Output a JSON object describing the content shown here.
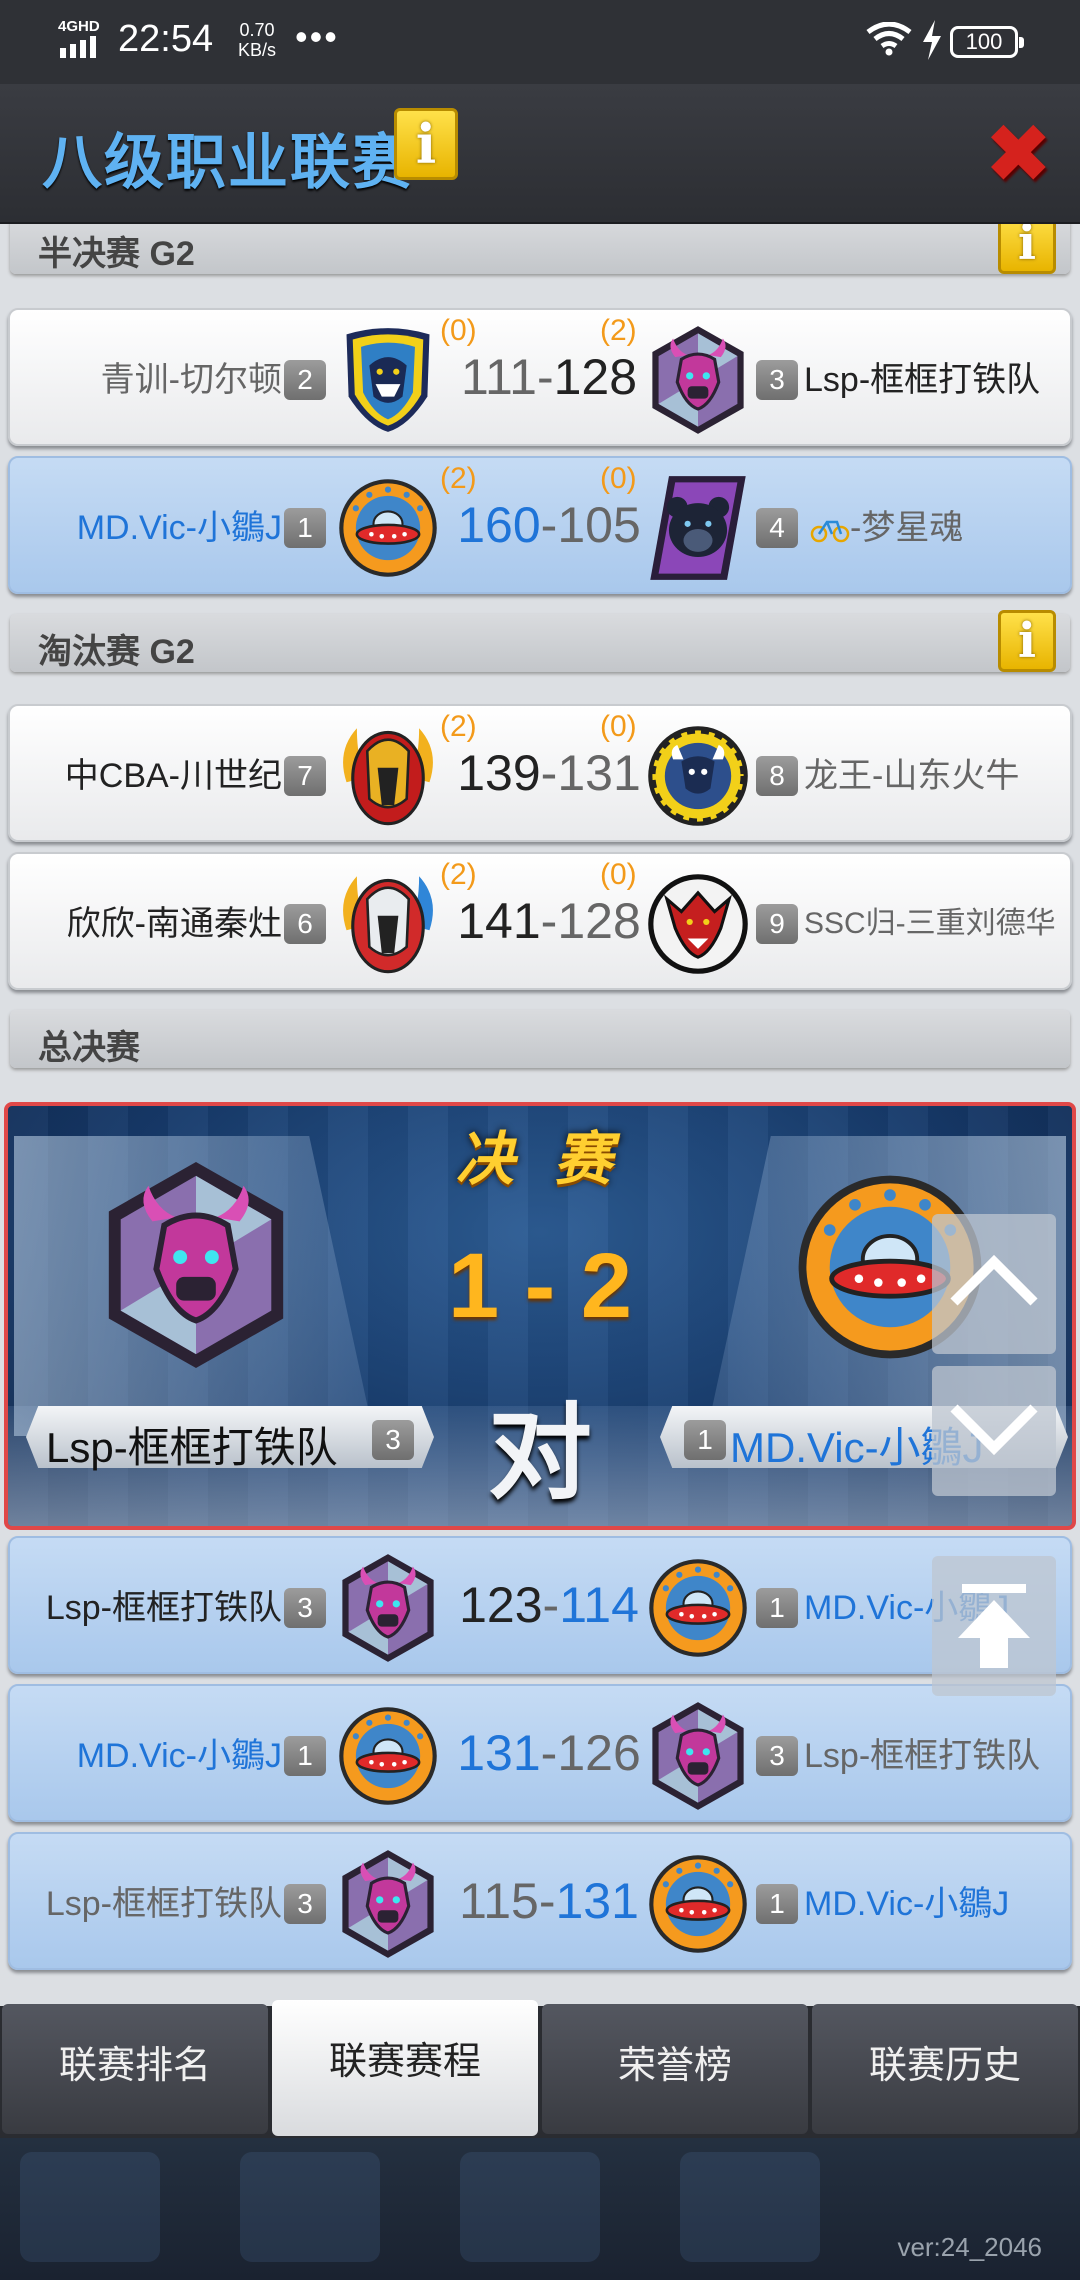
{
  "status_bar": {
    "network": "4GHD",
    "time": "22:54",
    "speed_value": "0.70",
    "speed_unit": "KB/s",
    "more": "•••",
    "battery": "100"
  },
  "header": {
    "title": "八级职业联赛",
    "info": "i",
    "close": "✖"
  },
  "sections": {
    "semifinal": "半决赛 G2",
    "elimination": "淘汰赛 G2",
    "final": "总决赛",
    "info": "i"
  },
  "semifinal_matches": [
    {
      "left_name": "青训-切尔顿",
      "left_seed": "2",
      "left_wins": "(0)",
      "left_score": "111",
      "dash": "-",
      "right_score": "128",
      "right_wins": "(2)",
      "right_seed": "3",
      "right_name": "Lsp-框框打铁队"
    },
    {
      "left_name": "MD.Vic-小鶵J",
      "left_seed": "1",
      "left_wins": "(2)",
      "left_score": "160",
      "dash": "-",
      "right_score": "105",
      "right_wins": "(0)",
      "right_seed": "4",
      "right_name": "-梦星魂",
      "right_icon": "bicycle-icon"
    }
  ],
  "elimination_matches": [
    {
      "left_name": "中CBA-川世纪",
      "left_seed": "7",
      "left_wins": "(2)",
      "left_score": "139",
      "dash": "-",
      "right_score": "131",
      "right_wins": "(0)",
      "right_seed": "8",
      "right_name": "龙王-山东火牛"
    },
    {
      "left_name": "欣欣-南通秦灶",
      "left_seed": "6",
      "left_wins": "(2)",
      "left_score": "141",
      "dash": "-",
      "right_score": "128",
      "right_wins": "(0)",
      "right_seed": "9",
      "right_name": "SSC归-三重刘德华"
    }
  ],
  "final": {
    "title": "决 赛",
    "score": "1 - 2",
    "vs": "对",
    "left_name": "Lsp-框框打铁队",
    "left_seed": "3",
    "right_name": "MD.Vic-小鶵J",
    "right_seed": "1"
  },
  "final_games": [
    {
      "left_name": "Lsp-框框打铁队",
      "left_seed": "3",
      "left_score": "123",
      "dash": "-",
      "right_score": "114",
      "right_seed": "1",
      "right_name": "MD.Vic-小鶵J"
    },
    {
      "left_name": "MD.Vic-小鶵J",
      "left_seed": "1",
      "left_score": "131",
      "dash": "-",
      "right_score": "126",
      "right_seed": "3",
      "right_name": "Lsp-框框打铁队"
    },
    {
      "left_name": "Lsp-框框打铁队",
      "left_seed": "3",
      "left_score": "115",
      "dash": "-",
      "right_score": "131",
      "right_seed": "1",
      "right_name": "MD.Vic-小鶵J"
    }
  ],
  "tabs": [
    {
      "label": "联赛排名",
      "active": false
    },
    {
      "label": "联赛赛程",
      "active": true
    },
    {
      "label": "荣誉榜",
      "active": false
    },
    {
      "label": "联赛历史",
      "active": false
    }
  ],
  "version": "ver:24_2046",
  "colors": {
    "title_blue": "#5fb2f2",
    "highlight_blue": "#1f74d8",
    "wins_orange": "#f39a1a",
    "final_score": "#ffb61e",
    "close_red": "#d5221d"
  }
}
